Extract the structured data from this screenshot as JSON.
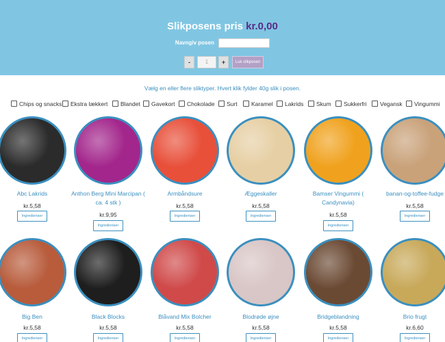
{
  "header": {
    "title_prefix": "Slikposens pris ",
    "price": "kr.0,00",
    "name_label": "Navngiv posen",
    "name_value": "",
    "minus_label": "-",
    "quantity": "1",
    "plus_label": "+",
    "close_label": "Luk slikposen"
  },
  "instruction": "Vælg en eller flere sliktyper. Hvert klik fylder 40g slik i posen.",
  "filters": [
    "Chips og snacks",
    "Ekstra lækkert",
    "Blandet",
    "Gavekort",
    "Chokolade",
    "Surt",
    "Karamel",
    "Lakrids",
    "Skum",
    "Sukkerfri",
    "Vegansk",
    "Vingummi"
  ],
  "ingredients_label": "Ingredienser",
  "products": [
    {
      "name": "Abc Lakrids",
      "price": "kr.5,58",
      "color": "#2b2b2b"
    },
    {
      "name": "Anthon Berg Mini Marcipan ( ca. 4 stk )",
      "price": "kr.9,95",
      "color": "#a3268c"
    },
    {
      "name": "Armbåndsure",
      "price": "kr.5,58",
      "color": "#e8503a"
    },
    {
      "name": "Æggeskaller",
      "price": "kr.5,58",
      "color": "#e6cfa4"
    },
    {
      "name": "Bamser Vingummi ( Candynavia)",
      "price": "kr.5,58",
      "color": "#f0a21e"
    },
    {
      "name": "banan-og-toffee-fudge",
      "price": "kr.5,58",
      "color": "#c9a27a"
    },
    {
      "name": "Big Ben",
      "price": "kr.5,58",
      "color": "#b85c3c"
    },
    {
      "name": "Black Blocks",
      "price": "kr.5,58",
      "color": "#1e1e1e"
    },
    {
      "name": "Blåvand Mix Bolcher",
      "price": "kr.5,58",
      "color": "#d04a4a"
    },
    {
      "name": "Blodrøde øjne",
      "price": "kr.5,58",
      "color": "#d9c6c6"
    },
    {
      "name": "Bridgeblandning",
      "price": "kr.5,58",
      "color": "#6b4a34"
    },
    {
      "name": "Brio frugt",
      "price": "kr.6,60",
      "color": "#c8a95a"
    }
  ]
}
